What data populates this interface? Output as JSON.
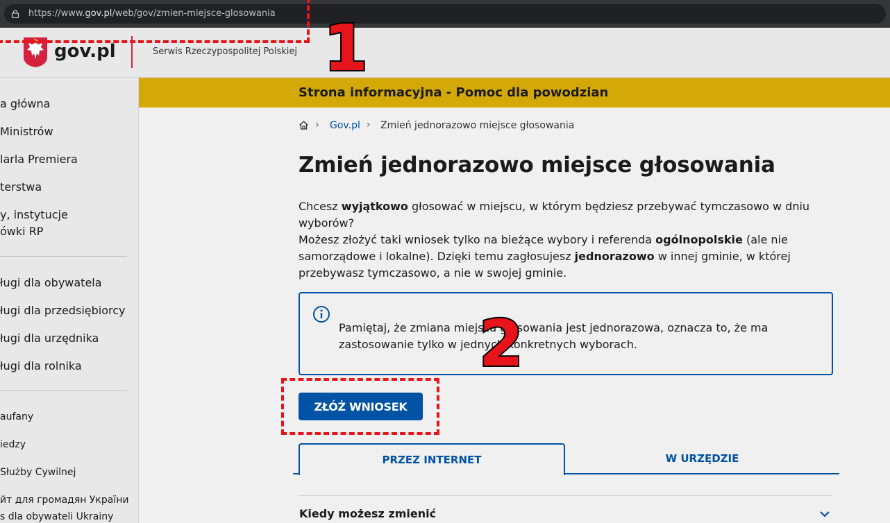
{
  "browser": {
    "url_prefix": "https://www.",
    "url_host": "gov.pl",
    "url_path": "/web/gov/zmien-miejsce-glosowania"
  },
  "header": {
    "logo": "gov.pl",
    "service_name": "Serwis Rzeczypospolitej Polskiej"
  },
  "sidebar": {
    "items": [
      "a główna",
      "Ministrów",
      "larla Premiera",
      "terstwa",
      "y, instytucje",
      "ówki RP",
      "ługi dla obywatela",
      "ługi dla przedsiębiorcy",
      "ługi dla urzędnika",
      "ługi dla rolnika",
      "aufany",
      "iedzy",
      "Służby Cywilnej",
      "йт для громадян України",
      "s dla obywateli Ukrainy"
    ]
  },
  "banner": {
    "text": "Strona informacyjna - Pomoc dla powodzian"
  },
  "breadcrumb": {
    "link": "Gov.pl",
    "current": "Zmień jednorazowo miejsce głosowania"
  },
  "page": {
    "title": "Zmień jednorazowo miejsce głosowania",
    "p1_a": "Chcesz ",
    "p1_b": "wyjątkowo",
    "p1_c": " głosować w miejscu, w którym będziesz przebywać tymczasowo w dniu wyborów?",
    "p2_a": "Możesz złożyć taki wniosek tylko na bieżące wybory i referenda ",
    "p2_b": "ogólnopolskie",
    "p2_c": " (ale nie samorządowe i lokalne). Dzięki temu zagłosujesz ",
    "p2_d": "jednorazowo",
    "p2_e": " w innej gminie, w której przebywasz tymczasowo, a nie w swojej gminie.",
    "info": "Pamiętaj, że zmiana miejsca głosowania jest jednorazowa, oznacza to, że ma zastosowanie tylko w jednych konkretnych wyborach.",
    "submit_label": "ZŁÓŻ WNIOSEK"
  },
  "tabs": [
    {
      "label": "PRZEZ INTERNET",
      "active": true
    },
    {
      "label": "W URZĘDZIE",
      "active": false
    }
  ],
  "accordion": {
    "title": "Kiedy możesz zmienić"
  },
  "annotations": {
    "num1": "1",
    "num2": "2"
  },
  "colors": {
    "primary": "#0052a5",
    "banner": "#d4a806",
    "annotation": "#e8141c"
  }
}
